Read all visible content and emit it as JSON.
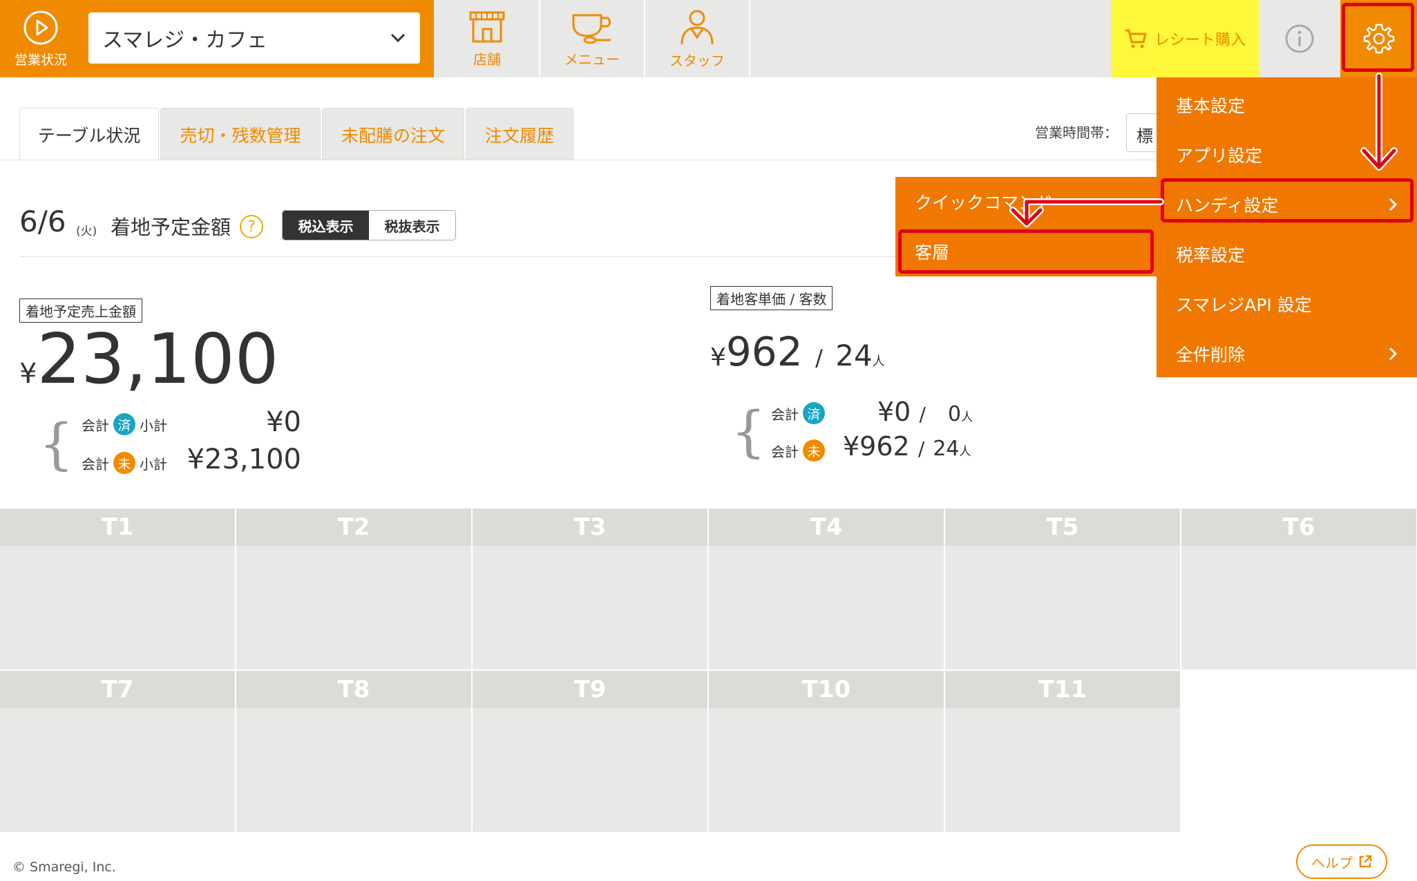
{
  "header": {
    "status_label": "営業状況",
    "store_name": "スマレジ・カフェ",
    "nav": [
      {
        "label": "店舗",
        "icon": "store-icon"
      },
      {
        "label": "メニュー",
        "icon": "coffee-cup-icon"
      },
      {
        "label": "スタッフ",
        "icon": "staff-icon"
      }
    ],
    "receipt_label": "レシート購入",
    "brand_color": "#f08a00"
  },
  "tabs": [
    {
      "label": "テーブル状況",
      "active": true
    },
    {
      "label": "売切・残数管理",
      "active": false
    },
    {
      "label": "未配膳の注文",
      "active": false
    },
    {
      "label": "注文履歴",
      "active": false
    }
  ],
  "hours": {
    "label": "営業時間帯：",
    "value": "標準"
  },
  "summary": {
    "date": "6/6",
    "day_of_week": "(火)",
    "title": "着地予定金額",
    "help": "?",
    "tax_included": "税込表示",
    "tax_excluded": "税抜表示",
    "sales_label": "着地予定売上金額",
    "yen": "¥",
    "sales_amount": "23,100",
    "paid_label_pre": "会計",
    "paid_badge": "済",
    "unpaid_badge": "未",
    "subtotal_label": "小計",
    "paid_amount": "¥0",
    "unpaid_amount": "¥23,100",
    "avg_label": "着地客単価 / 客数",
    "avg_amount": "962",
    "sep": "/",
    "guests": "24",
    "person_unit": "人",
    "paid_avg": "¥0",
    "paid_guests": "0",
    "unpaid_avg": "¥962",
    "unpaid_guests": "24"
  },
  "tables": [
    "T1",
    "T2",
    "T3",
    "T4",
    "T5",
    "T6",
    "T7",
    "T8",
    "T9",
    "T10",
    "T11"
  ],
  "settings_menu": {
    "items": [
      {
        "label": "基本設定",
        "has_sub": false
      },
      {
        "label": "アプリ設定",
        "has_sub": false
      },
      {
        "label": "ハンディ設定",
        "has_sub": true
      },
      {
        "label": "税率設定",
        "has_sub": false
      },
      {
        "label": "スマレジAPI 設定",
        "has_sub": false
      },
      {
        "label": "全件削除",
        "has_sub": true
      }
    ]
  },
  "handy_submenu": {
    "items": [
      {
        "label": "クイックコマンド"
      },
      {
        "label": "客層"
      }
    ]
  },
  "footer": {
    "copyright": "© Smaregi, Inc.",
    "help_label": "ヘルプ"
  }
}
